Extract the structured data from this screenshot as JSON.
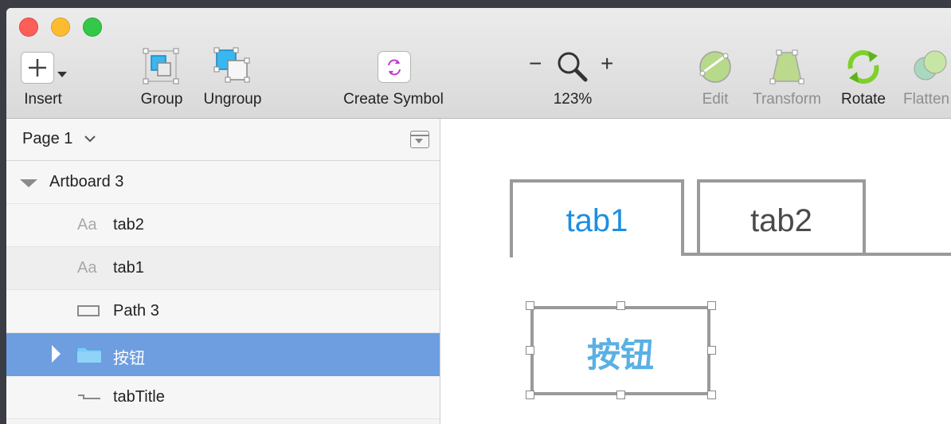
{
  "toolbar": {
    "insert_label": "Insert",
    "group_label": "Group",
    "ungroup_label": "Ungroup",
    "create_symbol_label": "Create Symbol",
    "zoom_value": "123%",
    "zoom_minus": "−",
    "zoom_plus": "+",
    "edit_label": "Edit",
    "transform_label": "Transform",
    "rotate_label": "Rotate",
    "flatten_label": "Flatten"
  },
  "sidebar": {
    "page_name": "Page 1",
    "artboard": "Artboard 3",
    "layers": [
      {
        "icon": "text-layer-icon",
        "icon_text": "Aa",
        "label": "tab2"
      },
      {
        "icon": "text-layer-icon",
        "icon_text": "Aa",
        "label": "tab1"
      },
      {
        "icon": "rectangle-shape-icon",
        "label": "Path 3"
      },
      {
        "icon": "folder-icon",
        "label": "按钮"
      },
      {
        "icon": "path-line-icon",
        "label": "tabTitle"
      }
    ]
  },
  "canvas": {
    "tab1": "tab1",
    "tab2": "tab2",
    "button_text": "按钮",
    "active_tab_color": "#1d8ee0",
    "inactive_tab_color": "#4a4a4a"
  }
}
